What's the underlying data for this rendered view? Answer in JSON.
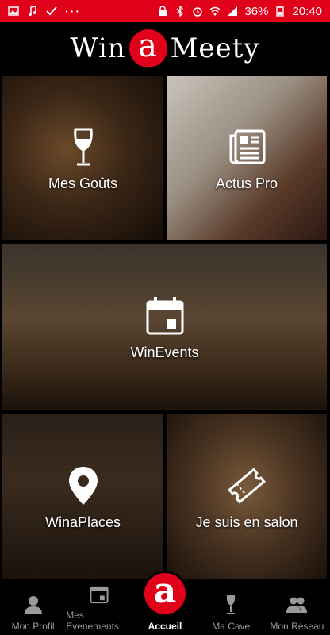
{
  "status_bar": {
    "left_icons": [
      "image-icon",
      "music-icon",
      "check-icon"
    ],
    "dots": "···",
    "battery_percent": "36%",
    "time": "20:40"
  },
  "header": {
    "logo_left": "Win",
    "logo_center": "a",
    "logo_right": "Meety"
  },
  "tiles": {
    "mes_gouts": "Mes Goûts",
    "actus_pro": "Actus Pro",
    "winevents": "WinEvents",
    "winaplaces": "WinaPlaces",
    "salon": "Je suis en salon"
  },
  "bottom_nav": {
    "profil": "Mon Profil",
    "evenements": "Mes Evenements",
    "accueil": "Accueil",
    "accueil_icon_letter": "a",
    "cave": "Ma Cave",
    "reseau": "Mon Réseau"
  },
  "colors": {
    "brand": "#e0001a",
    "inactive": "#9a9a9a"
  }
}
